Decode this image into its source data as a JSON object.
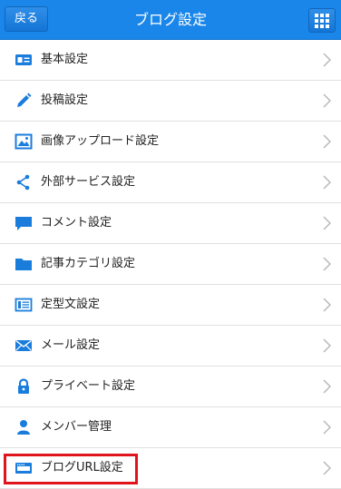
{
  "header": {
    "back_label": "戻る",
    "title": "ブログ設定",
    "grid_icon": "grid-menu-icon"
  },
  "menu": {
    "items": [
      {
        "label": "基本設定",
        "icon": "id-card-icon"
      },
      {
        "label": "投稿設定",
        "icon": "pencil-icon"
      },
      {
        "label": "画像アップロード設定",
        "icon": "image-icon"
      },
      {
        "label": "外部サービス設定",
        "icon": "share-icon"
      },
      {
        "label": "コメント設定",
        "icon": "comment-icon"
      },
      {
        "label": "記事カテゴリ設定",
        "icon": "folder-icon"
      },
      {
        "label": "定型文設定",
        "icon": "template-icon"
      },
      {
        "label": "メール設定",
        "icon": "envelope-icon"
      },
      {
        "label": "プライベート設定",
        "icon": "lock-icon"
      },
      {
        "label": "メンバー管理",
        "icon": "user-icon"
      },
      {
        "label": "ブログURL設定",
        "icon": "url-bar-icon"
      }
    ]
  },
  "colors": {
    "header_bg": "#1a86ea",
    "icon": "#1a7ddc",
    "highlight": "#e0141b",
    "chevron": "#b8b8b8"
  }
}
